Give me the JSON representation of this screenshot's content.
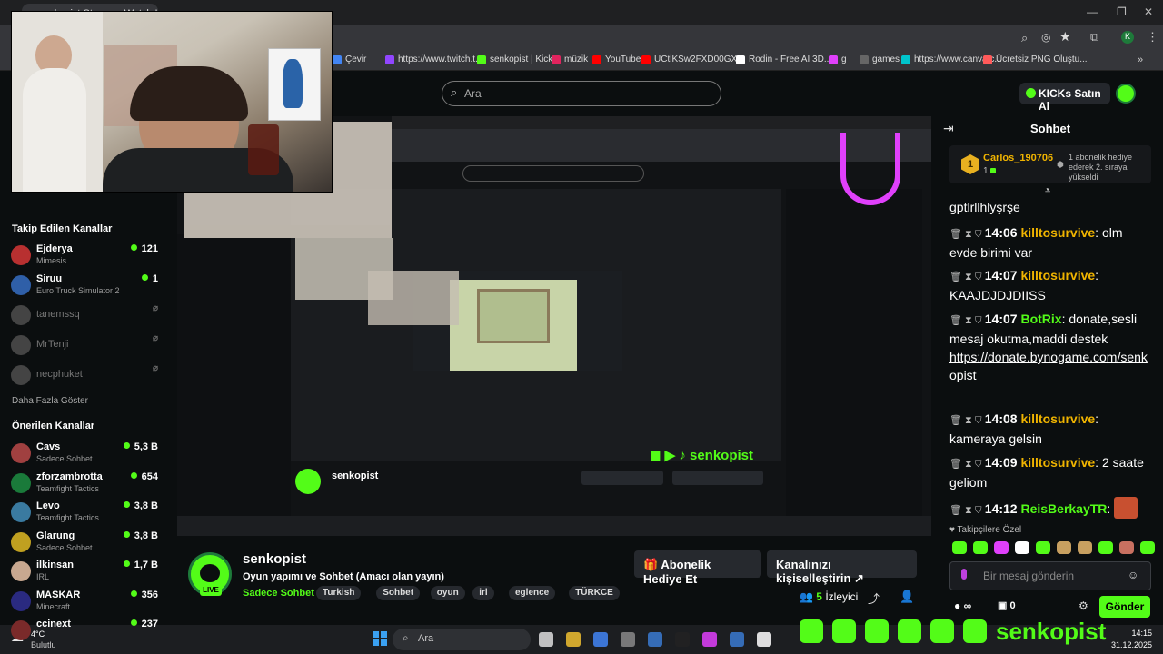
{
  "browser": {
    "tab_title": "senkopist Stream - Watch Live",
    "bookmarks": [
      {
        "label": "Çevir",
        "color": "#4285f4"
      },
      {
        "label": "https://www.twitch.t...",
        "color": "#9146ff"
      },
      {
        "label": "senkopist | Kick",
        "color": "#53fc18"
      },
      {
        "label": "müzik",
        "color": "#e0245e"
      },
      {
        "label": "YouTube",
        "color": "#ff0000"
      },
      {
        "label": "UCtlKSw2FXD00GX...",
        "color": "#ff0000"
      },
      {
        "label": "Rodin - Free AI 3D...",
        "color": "#ffffff"
      },
      {
        "label": "g",
        "color": "#e040fb"
      },
      {
        "label": "games",
        "color": "#666666"
      },
      {
        "label": "https://www.canva.c...",
        "color": "#00c4cc"
      },
      {
        "label": "Ücretsiz PNG Oluştu...",
        "color": "#ff5a5a"
      }
    ],
    "profile_initial": "K"
  },
  "header": {
    "search_placeholder": "Ara",
    "buy_kicks": "KICKs Satın Al"
  },
  "sidebar": {
    "following_title": "Takip Edilen Kanallar",
    "following": [
      {
        "name": "Ejderya",
        "game": "Mimesis",
        "viewers": "121",
        "online": true,
        "color": "#b83030"
      },
      {
        "name": "Siruu",
        "game": "Euro Truck Simulator 2",
        "viewers": "1",
        "online": true,
        "color": "#2f5fa8"
      },
      {
        "name": "tanemssq",
        "online": false
      },
      {
        "name": "MrTenji",
        "online": false
      },
      {
        "name": "necphuket",
        "online": false
      }
    ],
    "show_more": "Daha Fazla Göster",
    "recommended_title": "Önerilen Kanallar",
    "recommended": [
      {
        "name": "Cavs",
        "game": "Sadece Sohbet",
        "viewers": "5,3 B",
        "color": "#a04040"
      },
      {
        "name": "zforzambrotta",
        "game": "Teamfight Tactics",
        "viewers": "654",
        "color": "#1a7a3a"
      },
      {
        "name": "Levo",
        "game": "Teamfight Tactics",
        "viewers": "3,8 B",
        "color": "#3a7aa0"
      },
      {
        "name": "Glarung",
        "game": "Sadece Sohbet",
        "viewers": "3,8 B",
        "color": "#c0a020"
      },
      {
        "name": "ilkinsan",
        "game": "IRL",
        "viewers": "1,7 B",
        "color": "#c8a890"
      },
      {
        "name": "MASKAR",
        "game": "Minecraft",
        "viewers": "356",
        "color": "#2a2a80"
      },
      {
        "name": "ccinext",
        "game": "",
        "viewers": "237",
        "color": "#7a2a2a"
      }
    ]
  },
  "stream": {
    "channel": "senkopist",
    "title": "Oyun yapımı ve Sohbet (Amacı olan yayın)",
    "category": "Sadece Sohbet",
    "tags": [
      "Turkish",
      "Sohbet",
      "oyun",
      "irl",
      "eglence",
      "TÜRKCE"
    ],
    "live_badge": "LIVE",
    "gift_button": "Abonelik Hediye Et",
    "customize_button": "Kanalınızı kişiselleştirin",
    "viewers": "5",
    "viewers_label": "İzleyici"
  },
  "chat": {
    "title": "Sohbet",
    "pinned_user": "Carlos_190706",
    "pinned_count": "1",
    "pinned_gift_rank": "1",
    "pinned_info": "1 abonelik hediye ederek 2. sıraya yükseldi",
    "first_line": "gptlrllhlyşrşe",
    "messages": [
      {
        "time": "14:06",
        "user": "killtosurvive",
        "text": "olm evde birimi var",
        "color": "#f0b400"
      },
      {
        "time": "14:07",
        "user": "killtosurvive",
        "text": "KAAJDJDJDIISS",
        "color": "#f0b400"
      },
      {
        "time": "14:07",
        "user": "BotRix",
        "text": "donate,sesli mesaj okutma,maddi destek",
        "link": "https://donate.bynogame.com/senkopist",
        "color": "#53fc18"
      },
      {
        "time": "14:08",
        "user": "killtosurvive",
        "text": "kameraya gelsin",
        "color": "#f0b400"
      },
      {
        "time": "14:09",
        "user": "killtosurvive",
        "text": "2 saate geliom",
        "color": "#f0b400"
      },
      {
        "time": "14:12",
        "user": "ReisBerkayTR",
        "text": "",
        "color": "#53fc18"
      }
    ],
    "subscribers_only": "Takipçilere Özel",
    "input_placeholder": "Bir mesaj gönderin",
    "infinity": "∞",
    "gift_count": "0",
    "send_button": "Gönder"
  },
  "taskbar": {
    "weather_temp": "4°C",
    "weather_desc": "Bulutlu",
    "search": "Ara",
    "time": "14:15",
    "date": "31.12.2025"
  },
  "overlay_text": "senkopist"
}
